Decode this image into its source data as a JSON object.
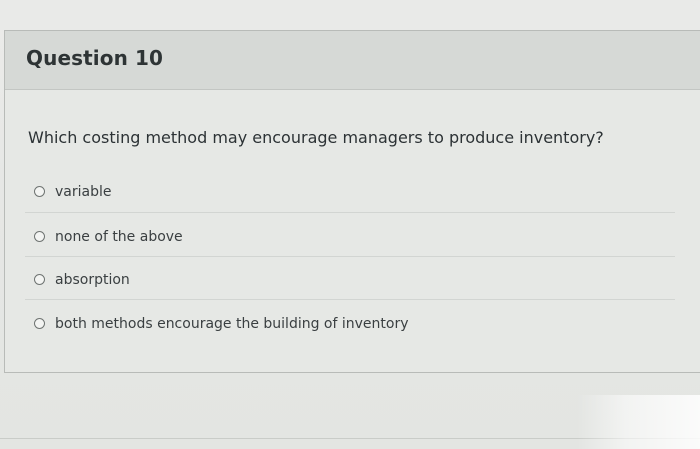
{
  "question": {
    "number_label": "Question 10",
    "text": "Which costing method may encourage managers to produce inventory?",
    "options": [
      {
        "label": "variable"
      },
      {
        "label": "none of the above"
      },
      {
        "label": "absorption"
      },
      {
        "label": "both methods encourage the building of inventory"
      }
    ]
  }
}
